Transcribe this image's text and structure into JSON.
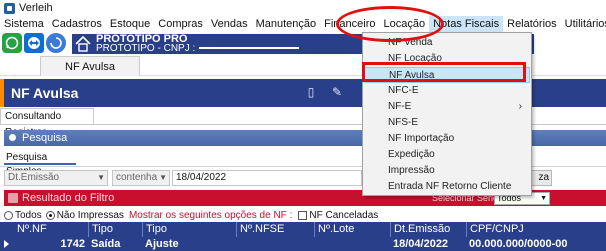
{
  "window": {
    "title": "Verleih"
  },
  "menubar": {
    "items": [
      "Sistema",
      "Cadastros",
      "Estoque",
      "Compras",
      "Vendas",
      "Manutenção",
      "Financeiro",
      "Locação",
      "Notas Fiscais",
      "Relatórios",
      "Utilitários"
    ],
    "active": "Notas Fiscais"
  },
  "toolbar": {
    "icons": [
      "whatsapp-icon",
      "teamviewer-icon",
      "refresh-icon"
    ]
  },
  "banner": {
    "title": "PROTOTIPO PRO",
    "subtitle": "PROTOTIPO - CNPJ :"
  },
  "tabs": {
    "active": "NF Avulsa"
  },
  "form": {
    "title": "NF Avulsa",
    "subtab": "Consultando Registros",
    "search_panel": "Pesquisa",
    "search_tab": "Pesquisa Simples",
    "field_name": "Dt.Emissão",
    "operator": "contenha",
    "date_value": "18/04/2022",
    "search_button_partial": "za"
  },
  "result": {
    "panel_title": "Resultado do Filtro",
    "series_label": "Selecionar Série :",
    "series_value": "Todos",
    "radio_all": "Todos",
    "radio_not_printed": "Não Impressas",
    "hint": "Mostrar os seguintes opções de NF :",
    "checkbox_cancelled": "NF Canceladas",
    "selected_radio": "Não Impressas"
  },
  "grid": {
    "columns": [
      "Nº.NF",
      "Tipo",
      "Tipo",
      "Nº.NFSE",
      "Nº.Lote",
      "Dt.Emissão",
      "CPF/CNPJ"
    ],
    "rows": [
      {
        "nf": "1742",
        "tipo1": "Saída",
        "tipo2": "Ajuste",
        "nfse": "",
        "lote": "",
        "emissao": "18/04/2022",
        "cpf": "00.000.000/0000-00"
      }
    ]
  },
  "dropdown": {
    "items": [
      {
        "label": "NF Venda",
        "submenu": false,
        "highlighted": false
      },
      {
        "label": "NF Locação",
        "submenu": false,
        "highlighted": false
      },
      {
        "label": "NF Avulsa",
        "submenu": false,
        "highlighted": true
      },
      {
        "label": "NFC-E",
        "submenu": false,
        "highlighted": false
      },
      {
        "label": "NF-E",
        "submenu": true,
        "highlighted": false
      },
      {
        "label": "NFS-E",
        "submenu": false,
        "highlighted": false
      },
      {
        "label": "NF Importação",
        "submenu": false,
        "highlighted": false
      },
      {
        "label": "Expedição",
        "submenu": false,
        "highlighted": false
      },
      {
        "label": "Impressão",
        "submenu": false,
        "highlighted": false
      },
      {
        "label": "Entrada NF Retorno Cliente",
        "submenu": false,
        "highlighted": false
      }
    ]
  },
  "colors": {
    "primary_blue": "#2a3f8a",
    "accent_orange": "#ff8c00",
    "result_red": "#c8102e",
    "annotation_red": "#e11010",
    "menu_highlight": "#cce4f7"
  }
}
